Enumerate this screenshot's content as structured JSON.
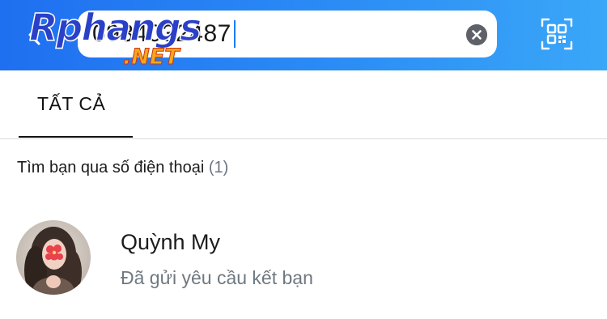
{
  "header": {
    "back_icon": "chevron-left-icon",
    "search": {
      "value": "0934032487"
    },
    "clear_icon": "clear-circle-icon",
    "qr_icon": "qr-code-icon",
    "watermark": {
      "main": "Rphangs",
      "sub": ".NET"
    }
  },
  "tabs": [
    {
      "label": "TẤT CẢ",
      "active": true
    }
  ],
  "section": {
    "title": "Tìm bạn qua số điện thoại",
    "count": "(1)"
  },
  "results": [
    {
      "name": "Quỳnh My",
      "status": "Đã gửi yêu cầu kết bạn",
      "avatar": "avatar-photo"
    }
  ],
  "colors": {
    "header_start": "#1f6ff0",
    "header_end": "#3aa7f8",
    "caret": "#1c7cf5",
    "muted_text": "#6f7880"
  }
}
